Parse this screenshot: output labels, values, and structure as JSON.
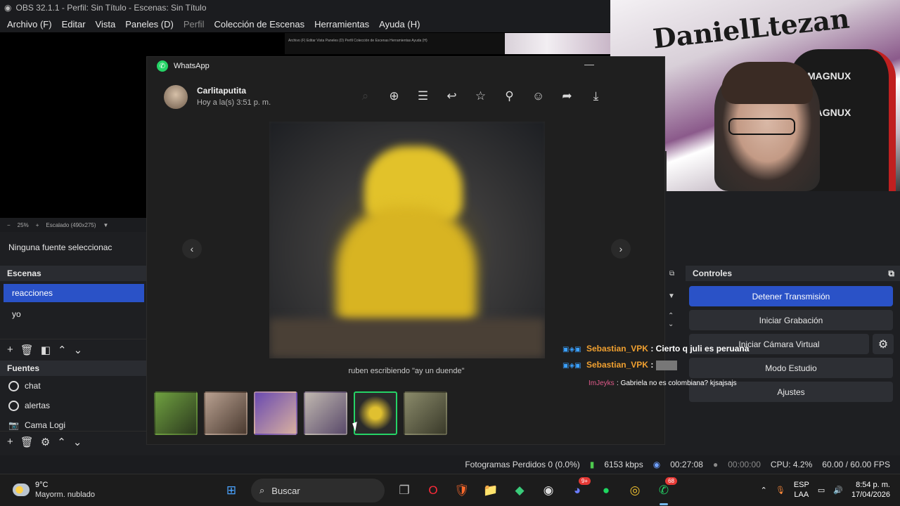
{
  "obs": {
    "title": "OBS 32.1.1 - Perfil: Sin Título - Escenas: Sin Título",
    "menu": [
      "Archivo (F)",
      "Editar",
      "Vista",
      "Paneles (D)",
      "Perfil",
      "Colección de Escenas",
      "Herramientas",
      "Ayuda (H)"
    ],
    "mini_menu": "Archivo (F)   Editar   Vista   Paneles (D)   Perfil   Colección de Escenas   Herramientas   Ayuda (H)",
    "preview_bar": {
      "minus": "−",
      "zoom": "25%",
      "plus": "+",
      "scale": "Escalado (490x275)",
      "dropdown": "▼"
    },
    "source_info": "Ninguna fuente seleccionac",
    "scenes": {
      "title": "Escenas",
      "items": [
        "reacciones",
        "yo"
      ]
    },
    "sources": {
      "title": "Fuentes",
      "items": [
        "chat",
        "alertas",
        "Cama Logi"
      ]
    },
    "controls": {
      "title": "Controles",
      "stop_stream": "Detener Transmisión",
      "start_recording": "Iniciar Grabación",
      "virtual_cam": "Iniciar Cámara Virtual",
      "studio_mode": "Modo Estudio",
      "settings": "Ajustes"
    },
    "status": {
      "dropped_frames": "Fotogramas Perdidos 0 (0.0%)",
      "bitrate": "6153 kbps",
      "stream_time": "00:27:08",
      "rec_time": "00:00:00",
      "cpu": "CPU: 4.2%",
      "fps": "60.00 / 60.00 FPS"
    }
  },
  "webcam": {
    "wall_text": "DanielLtezan",
    "chair_brand": "MAGNUX"
  },
  "whatsapp": {
    "app_title": "WhatsApp",
    "contact_name": "Carlitaputita",
    "timestamp": "Hoy a la(s) 3:51 p. m.",
    "caption": "ruben escribiendo \"ay un duende\"",
    "toolbar_icons": [
      "search-icon",
      "zoom-in-icon",
      "captions-icon",
      "reply-icon",
      "star-icon",
      "pin-icon",
      "react-icon",
      "forward-icon",
      "download-icon"
    ]
  },
  "chat": [
    {
      "user": "Sebastian_VPK",
      "message": "Cierto q juli es peruana"
    },
    {
      "user": "Sebastian_VPK",
      "message": ""
    },
    {
      "user": "ImJeyks",
      "message": "Gabriela no es colombiana? kjsajsajs"
    }
  ],
  "taskbar": {
    "weather_temp": "9°C",
    "weather_desc": "Mayorm. nublado",
    "search_placeholder": "Buscar",
    "discord_badge": "9+",
    "whatsapp_badge": "68",
    "lang_top": "ESP",
    "lang_bottom": "LAA",
    "time": "8:54 p. m.",
    "date": "17/04/2026"
  }
}
